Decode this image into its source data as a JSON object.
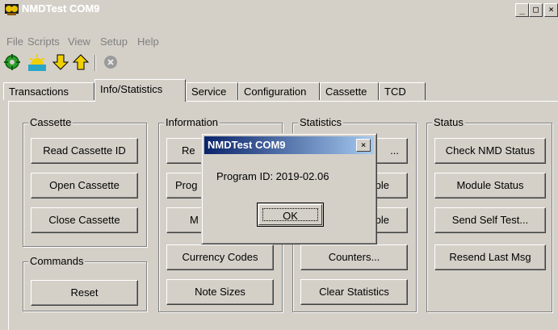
{
  "window": {
    "title": "NMDTest COM9",
    "minimize_glyph": "_",
    "maximize_glyph": "□",
    "close_glyph": "×"
  },
  "menu": [
    "File",
    "Scripts",
    "View",
    "Setup",
    "Help"
  ],
  "toolbar": {
    "icons": [
      "connect-icon",
      "sunrise-icon",
      "download-arrow-icon",
      "upload-arrow-icon",
      "stop-icon"
    ]
  },
  "tabs": [
    "Transactions",
    "Info/Statistics",
    "Service",
    "Configuration",
    "Cassette",
    "TCD"
  ],
  "active_tab": "Info/Statistics",
  "groups": {
    "cassette": {
      "label": "Cassette",
      "buttons": [
        "Read Cassette ID",
        "Open Cassette",
        "Close Cassette"
      ]
    },
    "commands": {
      "label": "Commands",
      "buttons": [
        "Reset"
      ]
    },
    "information": {
      "label": "Information",
      "buttons": [
        "Re",
        "Prog",
        "M",
        "Currency Codes",
        "Note Sizes"
      ]
    },
    "statistics": {
      "label": "Statistics",
      "buttons": [
        "...",
        "ble",
        "ble",
        "Counters...",
        "Clear Statistics"
      ]
    },
    "status": {
      "label": "Status",
      "buttons": [
        "Check NMD Status",
        "Module Status",
        "Send Self Test...",
        "Resend Last Msg"
      ]
    }
  },
  "dialog": {
    "title": "NMDTest COM9",
    "close_glyph": "×",
    "message": "Program ID: 2019-02.06",
    "ok_label": "OK"
  },
  "colors": {
    "face": "#d4d0c8",
    "title_gradient_start": "#0a246a",
    "title_gradient_end": "#a6caf0"
  }
}
